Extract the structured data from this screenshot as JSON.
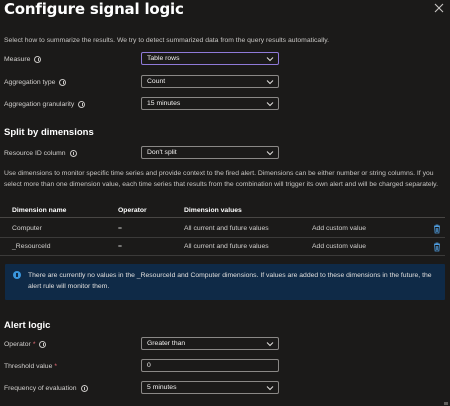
{
  "header": {
    "title": "Configure signal logic"
  },
  "intro": "Select how to summarize the results. We try to detect summarized data from the query results automatically.",
  "fields": {
    "measure": {
      "label": "Measure",
      "value": "Table rows"
    },
    "aggregation_type": {
      "label": "Aggregation type",
      "value": "Count"
    },
    "aggregation_granularity": {
      "label": "Aggregation granularity",
      "value": "15 minutes"
    }
  },
  "split": {
    "heading": "Split by dimensions",
    "resource_id_label": "Resource ID column",
    "resource_id_value": "Don't split",
    "description": "Use dimensions to monitor specific time series and provide context to the fired alert. Dimensions can be either number or string columns. If you select more than one dimension value, each time series that results from the combination will trigger its own alert and will be charged separately.",
    "columns": [
      "Dimension name",
      "Operator",
      "Dimension values"
    ],
    "rows": [
      {
        "name": "Computer",
        "operator": "=",
        "values": "All current and future values",
        "custom": "Add custom value"
      },
      {
        "name": "_ResourceId",
        "operator": "=",
        "values": "All current and future values",
        "custom": "Add custom value"
      }
    ],
    "info_banner": "There are currently no values in the _ResourceId and Computer dimensions. If values are added to these dimensions in the future, the alert rule will monitor them."
  },
  "alert_logic": {
    "heading": "Alert logic",
    "operator": {
      "label": "Operator",
      "required": "*",
      "value": "Greater than"
    },
    "threshold": {
      "label": "Threshold value",
      "required": "*",
      "value": "0"
    },
    "frequency": {
      "label": "Frequency of evaluation",
      "value": "5 minutes"
    }
  },
  "colors": {
    "background": "#1b1a19",
    "focus_border": "#8f7ad8",
    "banner_background": "#0f2a47",
    "info_blue": "#3a96dd",
    "delete_icon": "#4f9de0",
    "required_star": "#f1707b"
  }
}
